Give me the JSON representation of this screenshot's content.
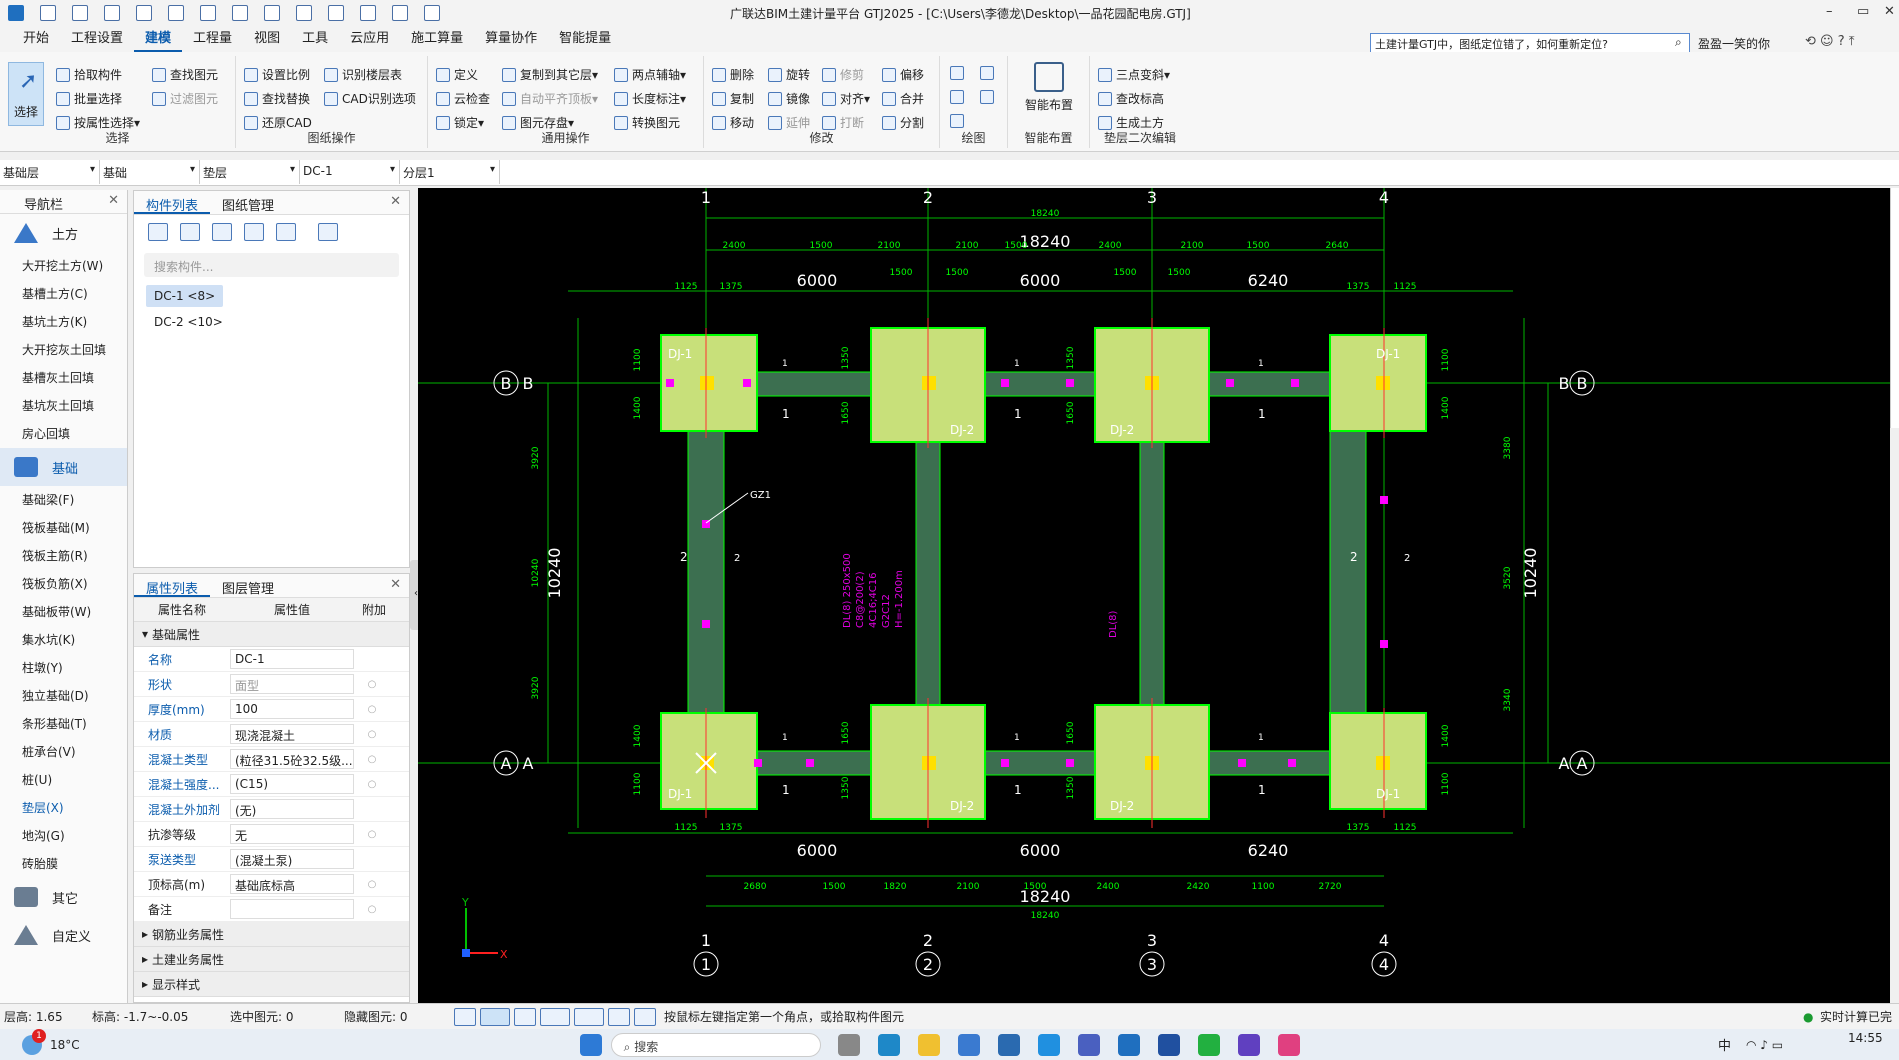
{
  "app": {
    "title": "广联达BIM土建计量平台 GTJ2025 - [C:\\Users\\李德龙\\Desktop\\一品花园配电房.GTJ]",
    "min": "–",
    "max": "▭",
    "close": "✕"
  },
  "menu": [
    "开始",
    "工程设置",
    "建模",
    "工程量",
    "视图",
    "工具",
    "云应用",
    "施工算量",
    "算量协作",
    "智能提量"
  ],
  "search": {
    "value": "土建计量GTJ中，图纸定位错了，如何重新定位?"
  },
  "user": "盈盈一笑的你",
  "ribbon": {
    "select": {
      "big": "选择",
      "items": [
        "拾取构件",
        "批量选择",
        "按属性选择",
        "查找图元",
        "过滤图元"
      ],
      "label": "选择"
    },
    "drawing": {
      "items": [
        "设置比例",
        "识别楼层表",
        "查找替换",
        "CAD识别选项",
        "还原CAD"
      ],
      "label": "图纸操作"
    },
    "common": {
      "items": [
        "定义",
        "复制到其它层",
        "两点辅轴",
        "云检查",
        "自动平齐顶板",
        "长度标注",
        "锁定",
        "图元存盘",
        "转换图元"
      ],
      "label": "通用操作"
    },
    "modify": {
      "items": [
        "删除",
        "旋转",
        "修剪",
        "偏移",
        "复制",
        "镜像",
        "对齐",
        "合并",
        "移动",
        "延伸",
        "打断",
        "分割"
      ],
      "label": "修改"
    },
    "draw": {
      "label": "绘图"
    },
    "smart": {
      "big": "智能布置",
      "label": "智能布置"
    },
    "cushion": {
      "items": [
        "三点变斜",
        "查改标高",
        "生成土方"
      ],
      "label": "垫层二次编辑"
    }
  },
  "filters": [
    "基础层",
    "基础",
    "垫层",
    "DC-1",
    "分层1"
  ],
  "nav": {
    "title": "导航栏",
    "groups": [
      {
        "name": "土方",
        "items": [
          "大开挖土方(W)",
          "基槽土方(C)",
          "基坑土方(K)",
          "大开挖灰土回填",
          "基槽灰土回填",
          "基坑灰土回填",
          "房心回填"
        ]
      },
      {
        "name": "基础",
        "items": [
          "基础梁(F)",
          "筏板基础(M)",
          "筏板主筋(R)",
          "筏板负筋(X)",
          "基础板带(W)",
          "集水坑(K)",
          "柱墩(Y)",
          "独立基础(D)",
          "条形基础(T)",
          "桩承台(V)",
          "桩(U)",
          "垫层(X)",
          "地沟(G)",
          "砖胎膜"
        ]
      },
      {
        "name": "其它",
        "items": []
      },
      {
        "name": "自定义",
        "items": []
      }
    ]
  },
  "components": {
    "tabs": [
      "构件列表",
      "图纸管理"
    ],
    "search_placeholder": "搜索构件...",
    "items": [
      "DC-1 <8>",
      "DC-2 <10>"
    ]
  },
  "properties": {
    "tabs": [
      "属性列表",
      "图层管理"
    ],
    "headers": [
      "属性名称",
      "属性值",
      "附加"
    ],
    "section": "基础属性",
    "rows": [
      {
        "name": "名称",
        "value": "DC-1"
      },
      {
        "name": "形状",
        "value": "面型"
      },
      {
        "name": "厚度(mm)",
        "value": "100"
      },
      {
        "name": "材质",
        "value": "现浇混凝土"
      },
      {
        "name": "混凝土类型",
        "value": "(粒径31.5砼32.5级..."
      },
      {
        "name": "混凝土强度...",
        "value": "(C15)"
      },
      {
        "name": "混凝土外加剂",
        "value": "(无)"
      },
      {
        "name": "抗渗等级",
        "value": "无"
      },
      {
        "name": "泵送类型",
        "value": "(混凝土泵)"
      },
      {
        "name": "顶标高(m)",
        "value": "基础底标高"
      },
      {
        "name": "备注",
        "value": ""
      }
    ],
    "sections": [
      "钢筋业务属性",
      "土建业务属性",
      "显示样式"
    ]
  },
  "cad": {
    "axes_x": [
      "1",
      "2",
      "3",
      "4"
    ],
    "axes_y": [
      "B",
      "A"
    ],
    "total": "18240",
    "total_small": "18240",
    "height": "10240",
    "spans": [
      "6000",
      "6000",
      "6240"
    ],
    "dims_top": [
      "2400",
      "1500",
      "2100",
      "2100",
      "1500",
      "2400",
      "2100",
      "1500",
      "2640"
    ],
    "dims_bot": [
      "2680",
      "1500",
      "1820",
      "2100",
      "1500",
      "2400",
      "2420",
      "1100",
      "2720"
    ],
    "dims_pad": [
      "1125",
      "1375",
      "1500",
      "1500",
      "1500",
      "1500",
      "1375",
      "1125"
    ],
    "left_dims": [
      "3920",
      "3920",
      "10240"
    ],
    "right_dims": [
      "3380",
      "3520",
      "3340"
    ],
    "pad_side": [
      "1100",
      "1400",
      "1350",
      "1650"
    ],
    "labels": {
      "dj1": "DJ-1",
      "dj2": "DJ-2",
      "gz": "GZ1",
      "dl1": "DL(8) 250x500",
      "dl2": "C8@200(2)",
      "dl3": "4C16;4C16",
      "dl4": "G2C12",
      "dl5": "H=-1.200m",
      "dlr": "DL(8)",
      "sec1": "1",
      "sec2": "2"
    },
    "ucs": {
      "x": "X",
      "y": "Y"
    }
  },
  "status": {
    "floor": "层高:  1.65",
    "elev": "标高:  -1.7~-0.05",
    "sel": "选中图元:  0",
    "hidden": "隐藏图元:  0",
    "hint": "按鼠标左键指定第一个角点，或拾取构件图元",
    "calc": "实时计算已完"
  },
  "taskbar": {
    "temp": "18°C",
    "search": "搜索",
    "time": "14:55",
    "lang": "中",
    "badge": "1"
  },
  "colors": {
    "accent": "#0b5cad",
    "canvas": "#000000",
    "pad": "#c8e07a",
    "beam": "#3c6f50",
    "dim": "#00c800"
  }
}
